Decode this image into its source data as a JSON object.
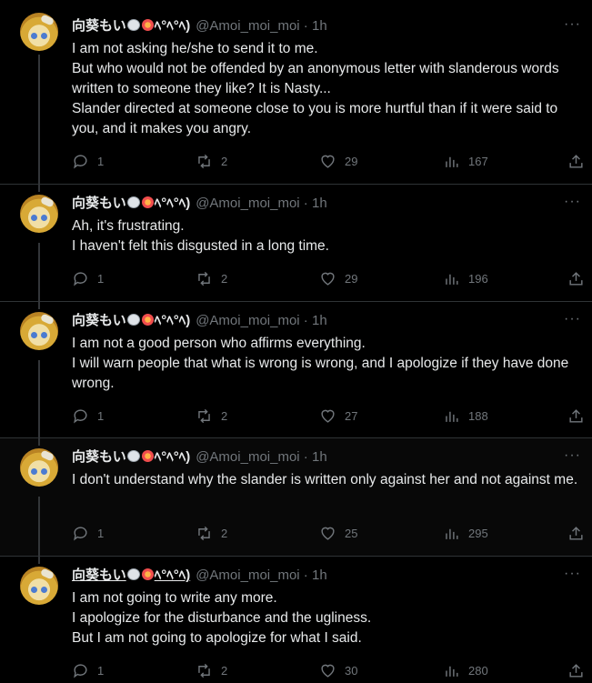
{
  "user": {
    "name": "向葵もい",
    "name_suffix": "ﾍ°ﾍ°ﾍ)",
    "handle": "@Amoi_moi_moi",
    "time": "1h"
  },
  "tweets": [
    {
      "lines": [
        "I am not asking he/she to send it to me.",
        "But who would not be offended by an anonymous letter with slanderous words written to someone they like? It is Nasty...",
        "Slander directed at someone close to you is more hurtful than if it were said to you, and it makes you angry."
      ],
      "replies": "1",
      "retweets": "2",
      "likes": "29",
      "views": "167"
    },
    {
      "lines": [
        "Ah, it's frustrating.",
        "I haven't felt this disgusted in a long time."
      ],
      "replies": "1",
      "retweets": "2",
      "likes": "29",
      "views": "196"
    },
    {
      "lines": [
        "I am not a good person who affirms everything.",
        "I will warn people that what is wrong is wrong, and I apologize if they have done wrong."
      ],
      "replies": "1",
      "retweets": "2",
      "likes": "27",
      "views": "188"
    },
    {
      "lines": [
        "I don't understand why the slander is written only against her and not against me."
      ],
      "replies": "1",
      "retweets": "2",
      "likes": "25",
      "views": "295"
    },
    {
      "lines": [
        "I am not going to write any more.",
        "I apologize for the disturbance and the ugliness.",
        "But I am not going to apologize for what I said."
      ],
      "replies": "1",
      "retweets": "2",
      "likes": "30",
      "views": "280"
    }
  ],
  "icons": {
    "more": "more-icon",
    "reply": "reply-icon",
    "retweet": "retweet-icon",
    "like": "heart-icon",
    "views": "views-icon",
    "share": "share-icon"
  }
}
